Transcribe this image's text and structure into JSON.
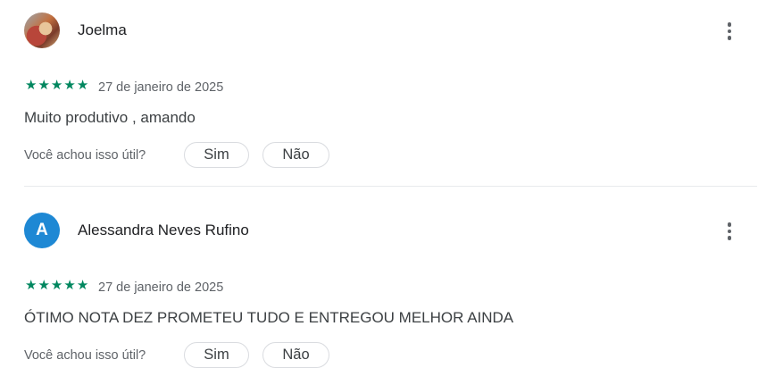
{
  "reviews": [
    {
      "author": "Joelma",
      "avatar_letter": "",
      "rating": 5,
      "stars": "★★★★★",
      "date": "27 de janeiro de 2025",
      "text": "Muito produtivo , amando",
      "helpful_question": "Você achou isso útil?",
      "yes_label": "Sim",
      "no_label": "Não"
    },
    {
      "author": "Alessandra Neves Rufino",
      "avatar_letter": "A",
      "avatar_color": "#1e88d4",
      "rating": 5,
      "stars": "★★★★★",
      "date": "27 de janeiro de 2025",
      "text": "ÓTIMO NOTA DEZ PROMETEU TUDO E ENTREGOU MELHOR AINDA",
      "helpful_question": "Você achou isso útil?",
      "yes_label": "Sim",
      "no_label": "Não"
    }
  ],
  "colors": {
    "star": "#01875f",
    "secondary_text": "#5f6368",
    "divider": "#e8eaed"
  },
  "icons": {
    "menu": "more-vert-icon",
    "star": "star-icon"
  }
}
